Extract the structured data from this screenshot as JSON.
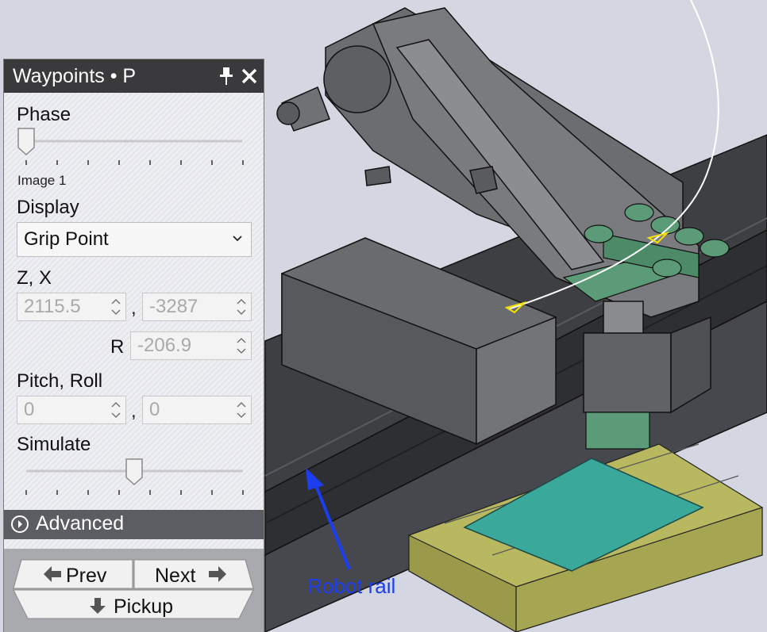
{
  "panel": {
    "title": "Waypoints • P",
    "phase": {
      "label": "Phase",
      "value_fraction": 0.0,
      "caption": "Image 1"
    },
    "display": {
      "label": "Display",
      "selected": "Grip Point"
    },
    "zx": {
      "label": "Z, X",
      "z": "2115.5",
      "x": "-3287"
    },
    "r": {
      "label": "R",
      "value": "-206.9"
    },
    "pitch_roll": {
      "label": "Pitch, Roll",
      "pitch": "0",
      "roll": "0"
    },
    "simulate": {
      "label": "Simulate",
      "value_fraction": 0.5
    },
    "advanced_label": "Advanced",
    "nav": {
      "prev": "Prev",
      "next": "Next",
      "pickup": "Pickup"
    }
  },
  "scene": {
    "rail_label": "Robot rail"
  },
  "colors": {
    "header": "#3a3a3c",
    "advanced": "#5c5d62",
    "annotation": "#1b3ef0",
    "gripper": "#5b9b78",
    "pallet": "#b8b860",
    "sheet": "#3aa89a"
  }
}
